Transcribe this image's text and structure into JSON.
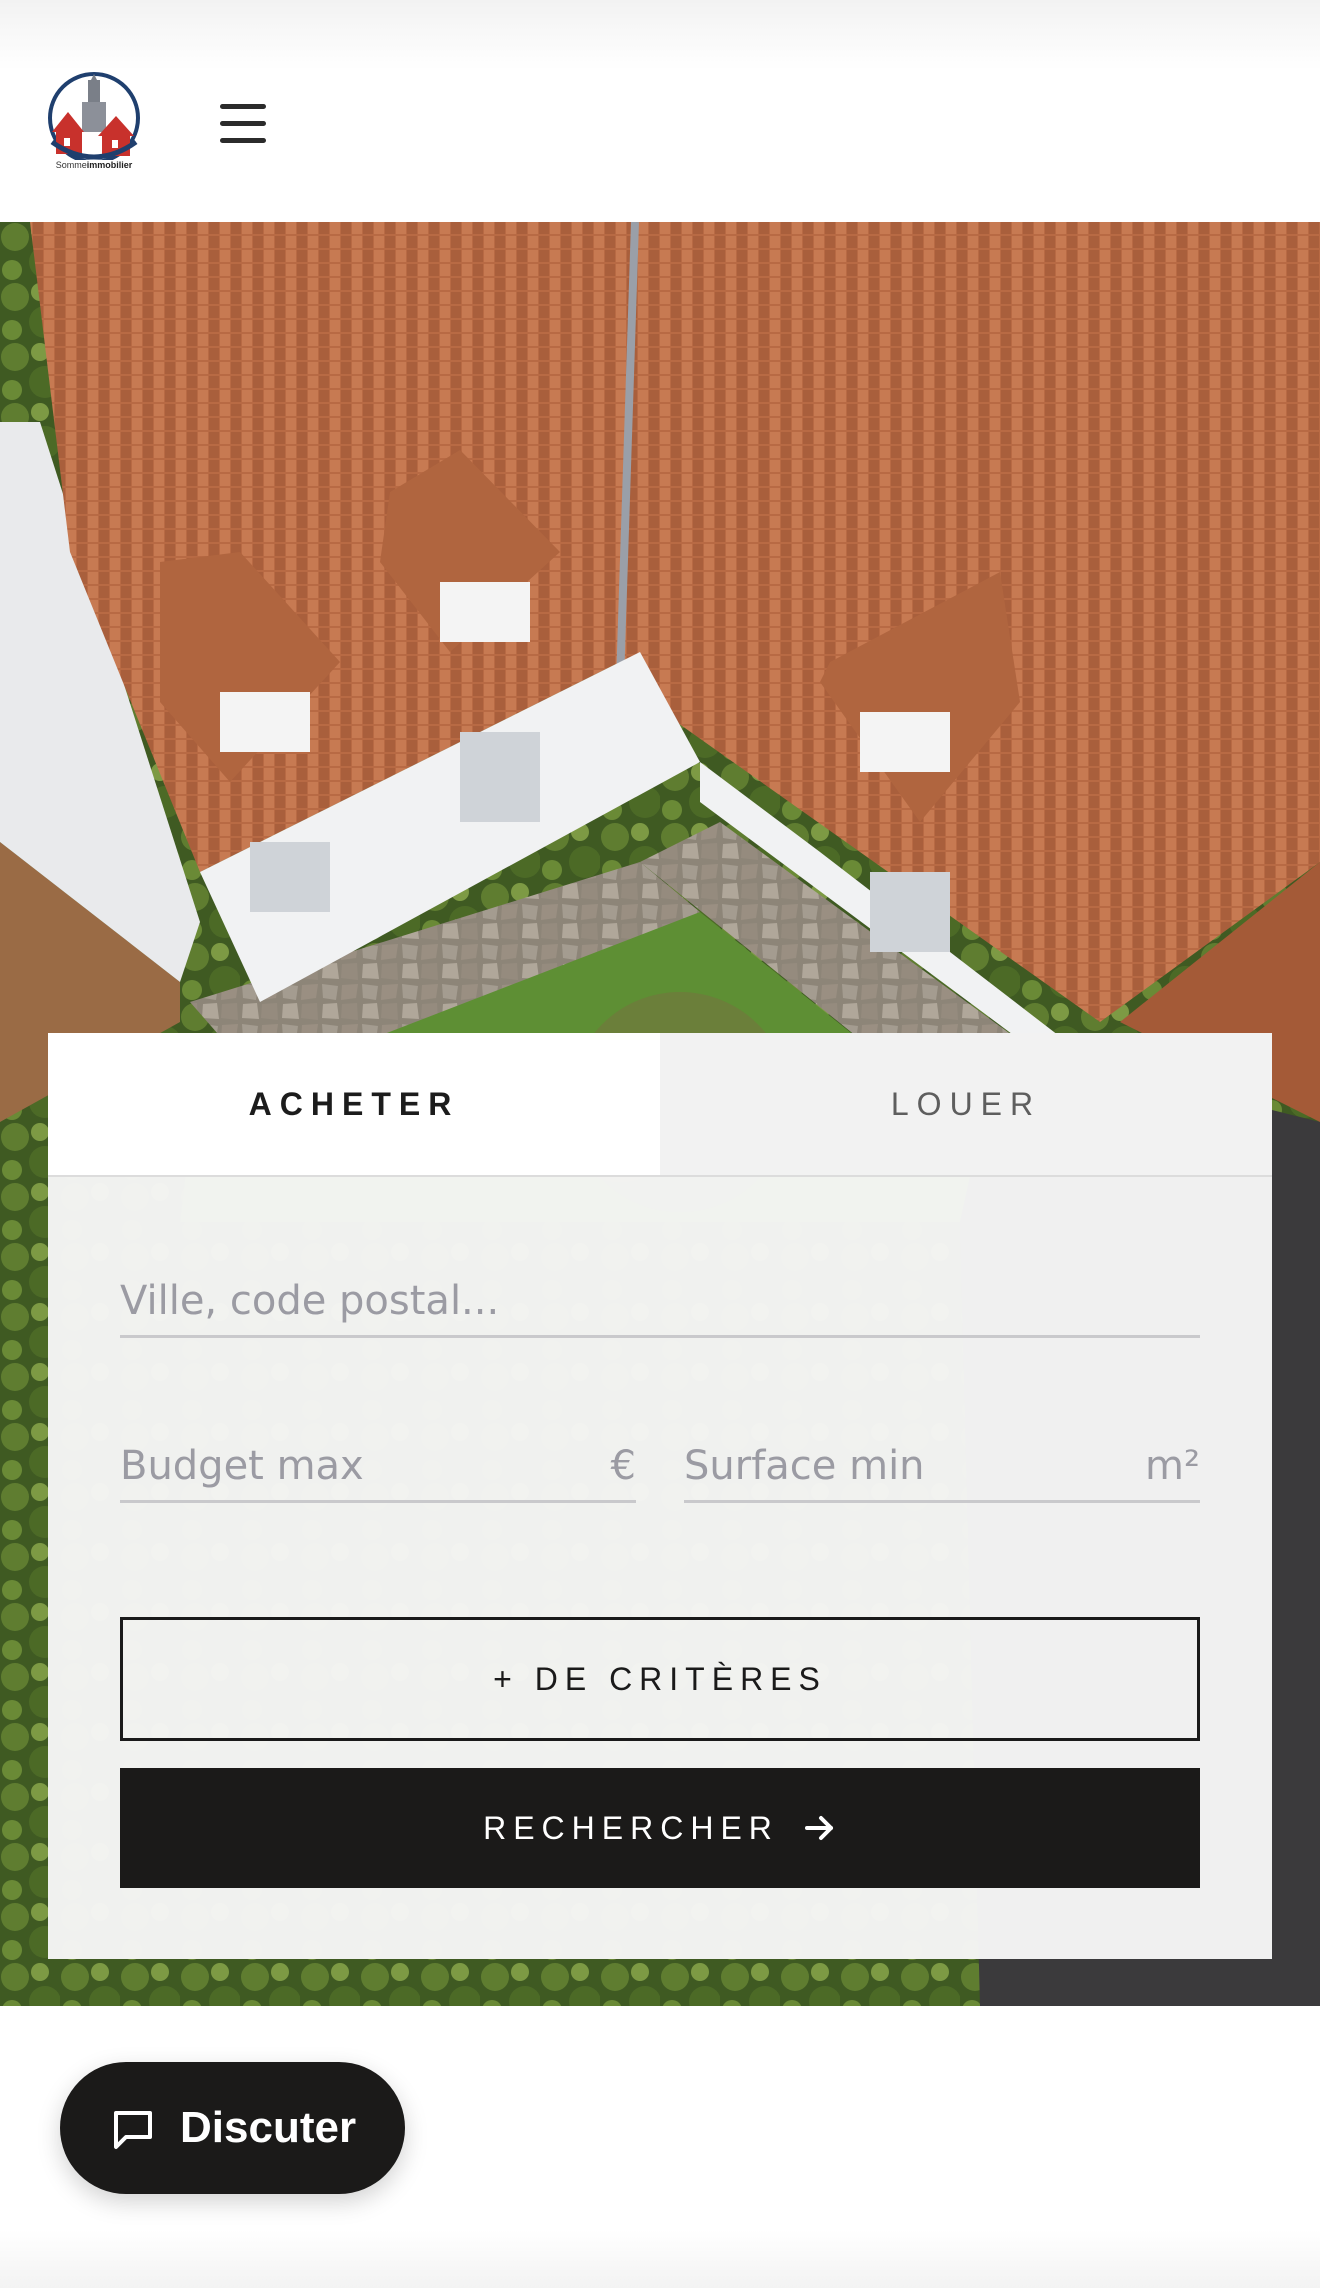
{
  "header": {
    "logo": {
      "icon": "house-church-logo",
      "text_prefix": "Somme",
      "text_suffix": "immobilier"
    },
    "menu_icon": "hamburger-menu-icon"
  },
  "hero": {
    "image_description_icon": "aerial-house-photo"
  },
  "search": {
    "tabs": [
      {
        "label": "ACHETER",
        "active": true
      },
      {
        "label": "LOUER",
        "active": false
      }
    ],
    "city_placeholder": "Ville, code postal...",
    "budget_placeholder": "Budget max",
    "budget_unit": "€",
    "surface_placeholder": "Surface min",
    "surface_unit": "m²",
    "criteria_button": "+ DE CRITÈRES",
    "search_button": "RECHERCHER",
    "search_icon": "arrow-right-icon"
  },
  "chat": {
    "label": "Discuter",
    "icon": "chat-bubble-icon"
  },
  "colors": {
    "dark": "#1b1a19",
    "placeholder": "#9b9ba3",
    "logo_blue": "#1f3f6e",
    "logo_red": "#c8312c"
  }
}
